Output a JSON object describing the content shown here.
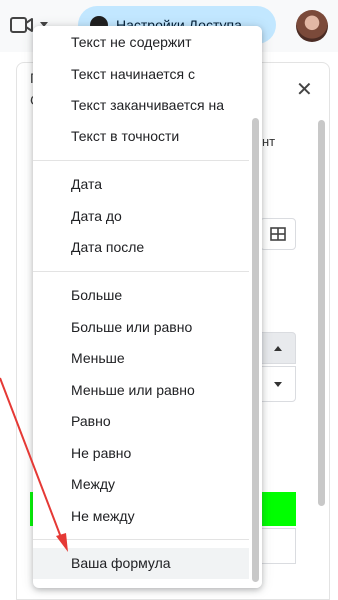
{
  "topbar": {
    "camera_icon": "video-camera-icon",
    "share_button_label": "Настройки Доступа",
    "avatar_icon": "user-avatar"
  },
  "side_panel": {
    "close_icon": "close-icon",
    "close_glyph": "✕",
    "partial_text_left_1": "Г",
    "partial_text_left_2": "С",
    "partial_text_right": "нт",
    "grid_icon": "grid-table-icon",
    "stepper_up_icon": "triangle-up-icon",
    "stepper_down_icon": "triangle-down-icon",
    "highlight_color": "#00ff00"
  },
  "condition_menu": {
    "group_text": [
      {
        "label": "Текст не содержит"
      },
      {
        "label": "Текст начинается с"
      },
      {
        "label": "Текст заканчивается на"
      },
      {
        "label": "Текст в точности"
      }
    ],
    "group_date": [
      {
        "label": "Дата"
      },
      {
        "label": "Дата до"
      },
      {
        "label": "Дата после"
      }
    ],
    "group_number": [
      {
        "label": "Больше"
      },
      {
        "label": "Больше или равно"
      },
      {
        "label": "Меньше"
      },
      {
        "label": "Меньше или равно"
      },
      {
        "label": "Равно"
      },
      {
        "label": "Не равно"
      },
      {
        "label": "Между"
      },
      {
        "label": "Не между"
      }
    ],
    "group_formula": [
      {
        "label": "Ваша формула",
        "hovered": true
      }
    ]
  },
  "annotation": {
    "arrow_color": "#e53935"
  }
}
